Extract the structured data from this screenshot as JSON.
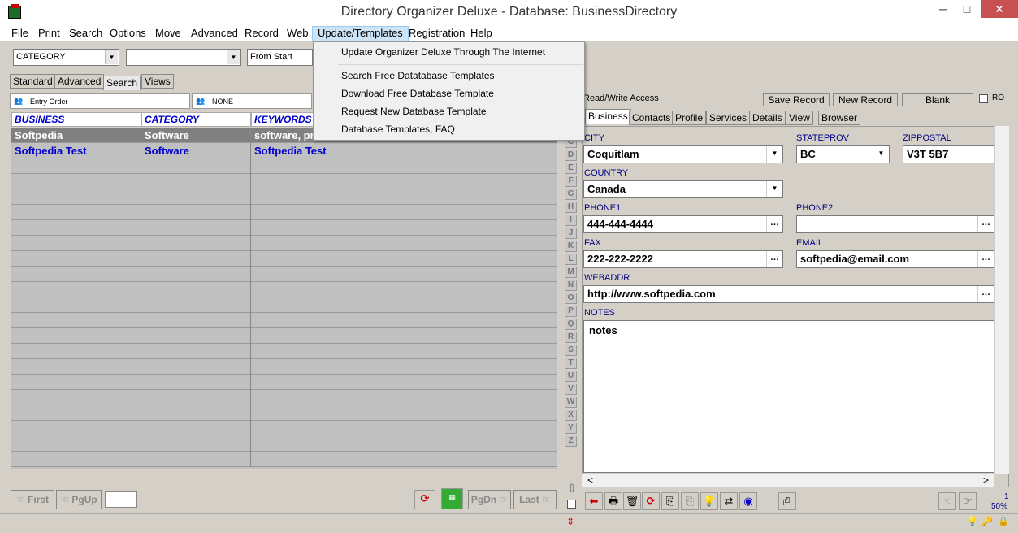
{
  "window": {
    "title": "Directory Organizer Deluxe - Database: BusinessDirectory",
    "minimize": "─",
    "maximize": "□",
    "close": "✕"
  },
  "menu": [
    "File",
    "Print",
    "Search",
    "Options",
    "Move",
    "Advanced",
    "Record",
    "Web",
    "Update/Templates",
    "Registration",
    "Help"
  ],
  "dropdown": {
    "items": [
      "Update Organizer Deluxe Through The Internet",
      "Search Free Datatabase Templates",
      "Download Free Database Template",
      "Request New Database Template",
      "Database Templates, FAQ"
    ]
  },
  "toolbar": {
    "category_combo": "CATEGORY",
    "second_combo": "",
    "from_start": "From Start"
  },
  "left_tabs": [
    "Standard",
    "Advanced",
    "Search",
    "Views"
  ],
  "sort": {
    "left": "Entry Order",
    "right": "NONE"
  },
  "grid": {
    "headers": [
      "BUSINESS",
      "CATEGORY",
      "KEYWORDS"
    ],
    "rows": [
      {
        "business": "Softpedia",
        "category": "Software",
        "keywords": "software, pro"
      },
      {
        "business": "Softpedia Test",
        "category": "Software",
        "keywords": "Softpedia Test"
      }
    ]
  },
  "letters": [
    "C",
    "D",
    "E",
    "F",
    "G",
    "H",
    "I",
    "J",
    "K",
    "L",
    "M",
    "N",
    "O",
    "P",
    "Q",
    "R",
    "S",
    "T",
    "U",
    "V",
    "W",
    "X",
    "Y",
    "Z"
  ],
  "nav": {
    "first": "First",
    "pgup": "PgUp",
    "pgdn": "PgDn",
    "last": "Last"
  },
  "right": {
    "access": "Read/Write Access",
    "save": "Save Record",
    "new": "New Record",
    "blank": "Blank",
    "ro": "RO",
    "tabs": [
      "Business",
      "Contacts",
      "Profile",
      "Services",
      "Details",
      "View",
      "Browser"
    ]
  },
  "form": {
    "city_label": "CITY",
    "city": "Coquitlam",
    "state_label": "STATEPROV",
    "state": "BC",
    "zip_label": "ZIPPOSTAL",
    "zip": "V3T 5B7",
    "country_label": "COUNTRY",
    "country": "Canada",
    "phone1_label": "PHONE1",
    "phone1": "444-444-4444",
    "phone2_label": "PHONE2",
    "phone2": "",
    "fax_label": "FAX",
    "fax": "222-222-2222",
    "email_label": "EMAIL",
    "email": "softpedia@email.com",
    "web_label": "WEBADDR",
    "web": "http://www.softpedia.com",
    "notes_label": "NOTES",
    "notes": "notes"
  },
  "status": {
    "count": "1",
    "zoom": "50%"
  }
}
